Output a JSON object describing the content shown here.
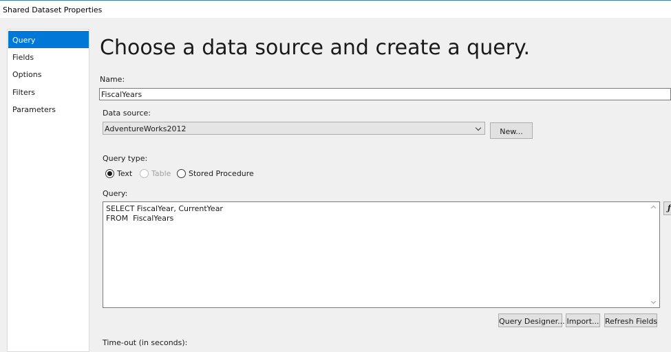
{
  "window": {
    "title": "Shared Dataset Properties"
  },
  "sidebar": {
    "items": [
      {
        "label": "Query",
        "selected": true
      },
      {
        "label": "Fields",
        "selected": false
      },
      {
        "label": "Options",
        "selected": false
      },
      {
        "label": "Filters",
        "selected": false
      },
      {
        "label": "Parameters",
        "selected": false
      }
    ]
  },
  "page": {
    "heading": "Choose a data source and create a query."
  },
  "name": {
    "label": "Name:",
    "value": "FiscalYears"
  },
  "data_source": {
    "label": "Data source:",
    "value": "AdventureWorks2012",
    "new_button": "New..."
  },
  "query_type": {
    "label": "Query type:",
    "options": [
      {
        "label": "Text",
        "checked": true,
        "enabled": true
      },
      {
        "label": "Table",
        "checked": false,
        "enabled": false
      },
      {
        "label": "Stored Procedure",
        "checked": false,
        "enabled": true
      }
    ]
  },
  "query": {
    "label": "Query:",
    "lines": [
      "SELECT FiscalYear, CurrentYear",
      "FROM  FiscalYears"
    ],
    "expression_button_icon": "fx-icon"
  },
  "buttons": {
    "query_designer": "Query Designer...",
    "import": "Import...",
    "refresh_fields": "Refresh Fields"
  },
  "timeout": {
    "label": "Time-out (in seconds):"
  },
  "colors": {
    "accent": "#0078d7",
    "title_border": "#3c7fb1",
    "background": "#f0f0f0"
  }
}
